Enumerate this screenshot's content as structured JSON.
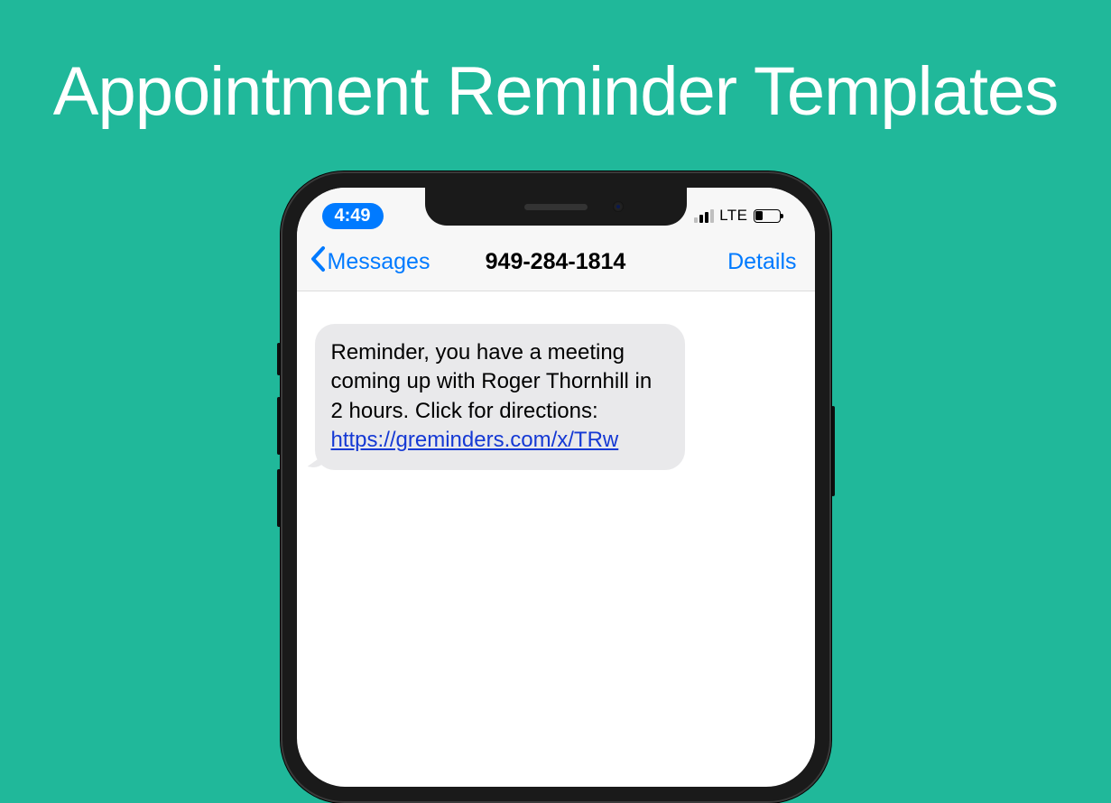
{
  "headline": "Appointment Reminder Templates",
  "status": {
    "time": "4:49",
    "network_label": "LTE"
  },
  "nav": {
    "back_label": "Messages",
    "title": "949-284-1814",
    "details_label": "Details"
  },
  "message": {
    "body_text": "Reminder, you have a meeting coming up with Roger Thornhill in 2 hours. Click for directions: ",
    "link_text": "https://greminders.com/x/TRw"
  }
}
